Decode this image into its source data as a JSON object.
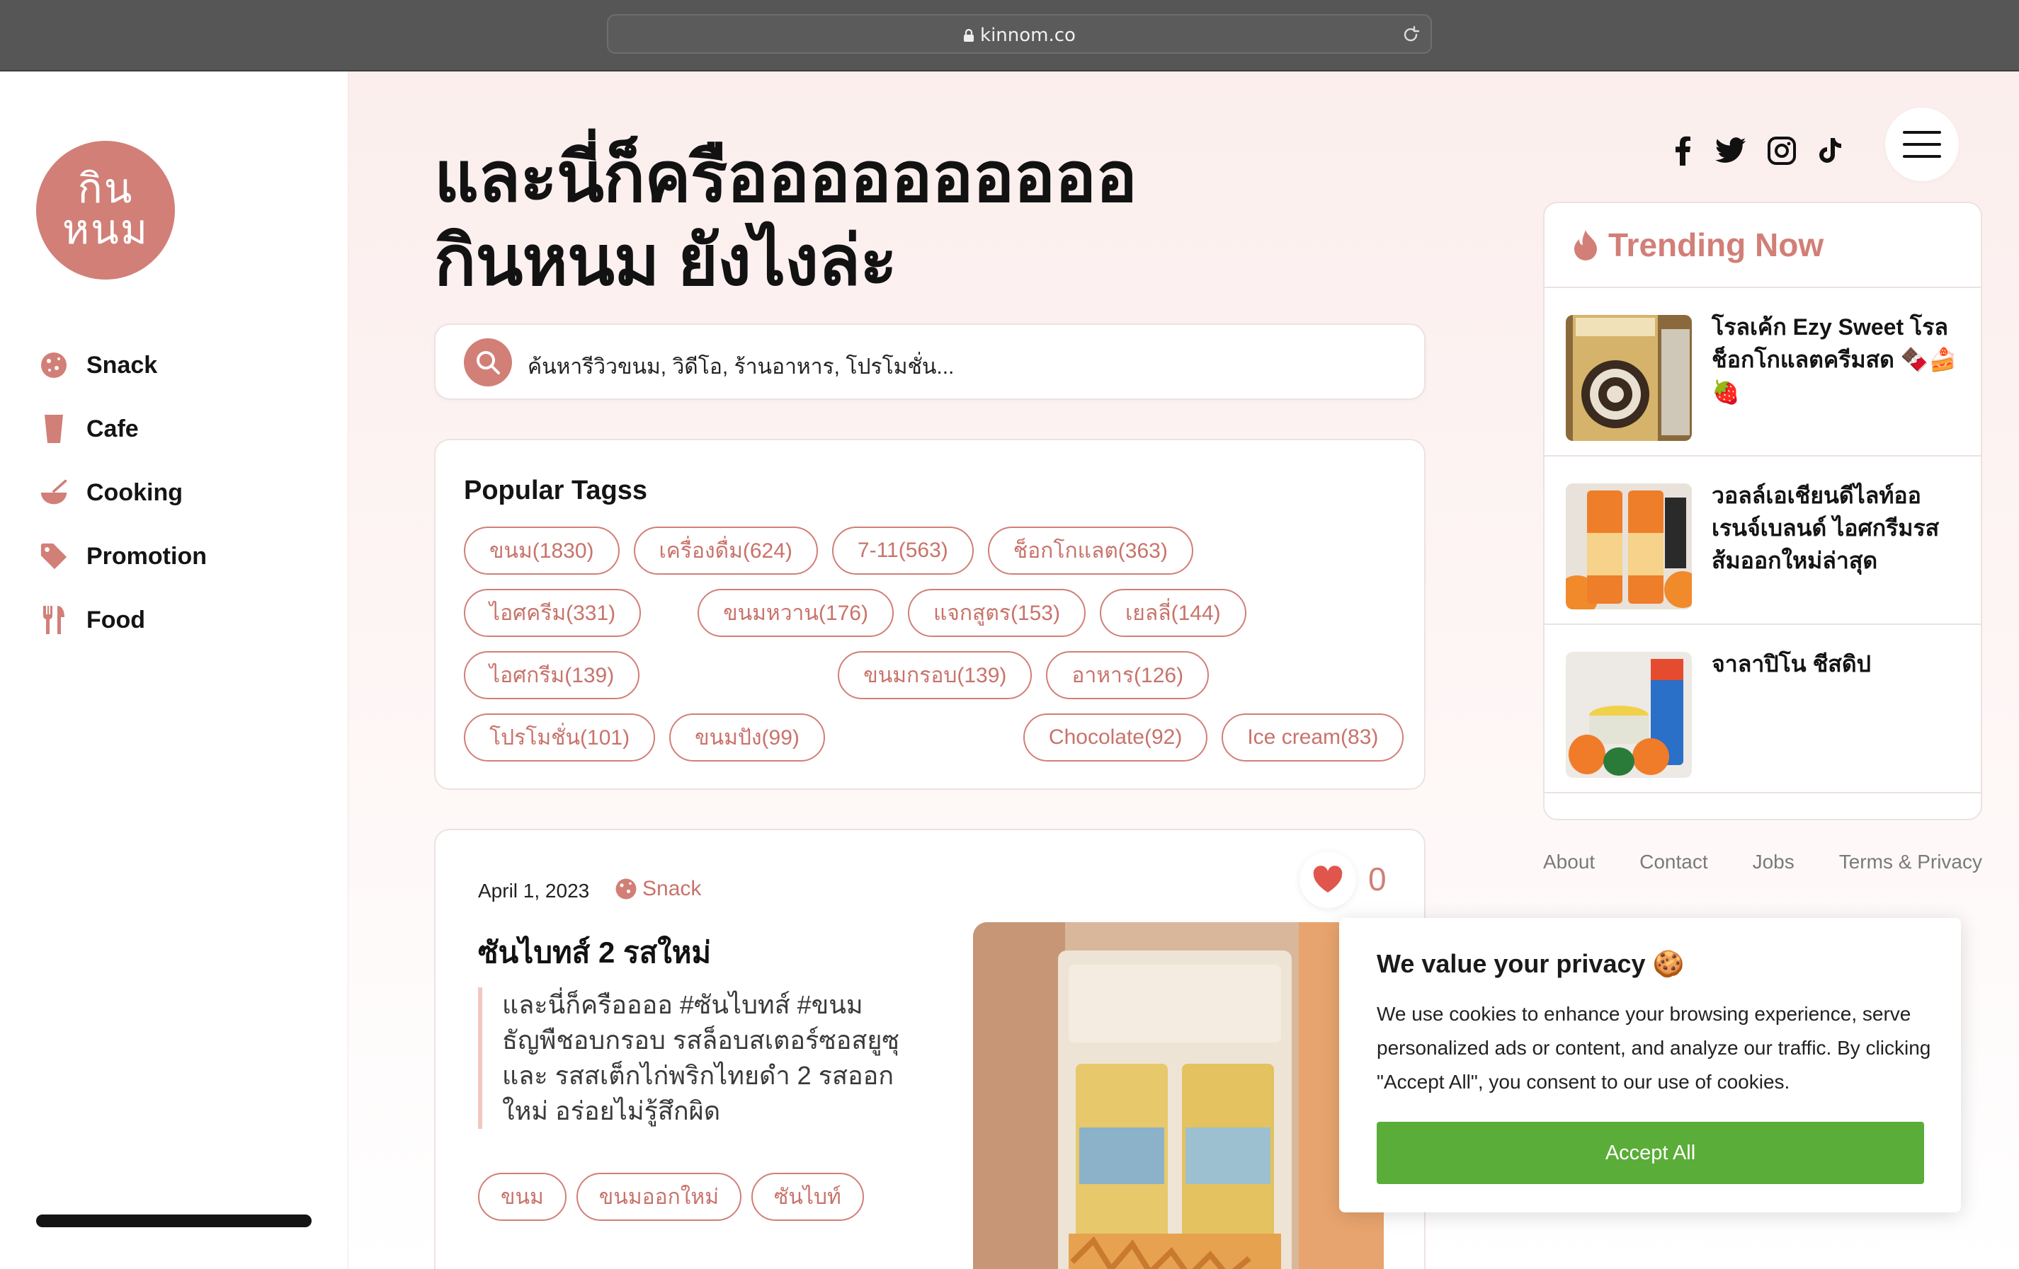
{
  "browser": {
    "url": "kinnom.co"
  },
  "logo": {
    "line1": "กิน",
    "line2": "หนม"
  },
  "sidebar": {
    "items": [
      {
        "label": "Snack",
        "icon": "cookie-icon"
      },
      {
        "label": "Cafe",
        "icon": "cup-icon"
      },
      {
        "label": "Cooking",
        "icon": "mixing-bowl-icon"
      },
      {
        "label": "Promotion",
        "icon": "price-tag-icon"
      },
      {
        "label": "Food",
        "icon": "fork-knife-icon"
      }
    ]
  },
  "hero": {
    "line1": "และนี่ก็ครืออออออออออ",
    "line2": "กินหนม ยังไงล่ะ"
  },
  "search": {
    "placeholder": "ค้นหารีวิวขนม, วิดีโอ, ร้านอาหาร, โปรโมชั่น..."
  },
  "popular_tags": {
    "title": "Popular Tagss",
    "tags": [
      "ขนม(1830)",
      "เครื่องดื่ม(624)",
      "7-11(563)",
      "ช็อกโกแลต(363)",
      "ไอศครีม(331)",
      "ขนมหวาน(176)",
      "แจกสูตร(153)",
      "เยลลี่(144)",
      "ไอศกรีม(139)",
      "ขนมกรอบ(139)",
      "อาหาร(126)",
      "โปรโมชั่น(101)",
      "ขนมปัง(99)",
      "Chocolate(92)",
      "Ice cream(83)"
    ]
  },
  "post": {
    "date": "April 1, 2023",
    "category": "Snack",
    "title": "ซันไบทส์ 2 รสใหม่",
    "excerpt": "และนี่ก็ครืออออ #ซันไบทส์ #ขนมธัญพืชอบกรอบ รสล็อบสเตอร์ซอสยูซุ และ รสสเต็กไก่พริกไทยดำ 2 รสออกใหม่ อร่อยไม่รู้สึกผิด",
    "tags": [
      "ขนม",
      "ขนมออกใหม่",
      "ซันไบท์"
    ],
    "likes": "0"
  },
  "social": [
    "facebook-icon",
    "twitter-icon",
    "instagram-icon",
    "tiktok-icon"
  ],
  "trending": {
    "title": "Trending Now",
    "items": [
      {
        "title": "โรลเค้ก Ezy Sweet โรลช็อกโกแลตครีมสด 🍫🍰🍓"
      },
      {
        "title": "วอลล์เอเชียนดีไลท์ออเรนจ์เบลนด์ ไอศกรีมรสส้มออกใหม่ล่าสุด"
      },
      {
        "title": "จาลาปิโน ชีสดิป"
      }
    ]
  },
  "footer": {
    "links": [
      "About",
      "Contact",
      "Jobs",
      "Terms & Privacy"
    ]
  },
  "cookie": {
    "title": "We value your privacy 🍪",
    "text": "We use cookies to enhance your browsing experience, serve personalized ads or content, and analyze our traffic. By clicking \"Accept All\", you consent to our use of cookies.",
    "accept_label": "Accept All"
  },
  "colors": {
    "accent": "#d17f77",
    "accept": "#5aad38",
    "chrome": "#565656"
  }
}
